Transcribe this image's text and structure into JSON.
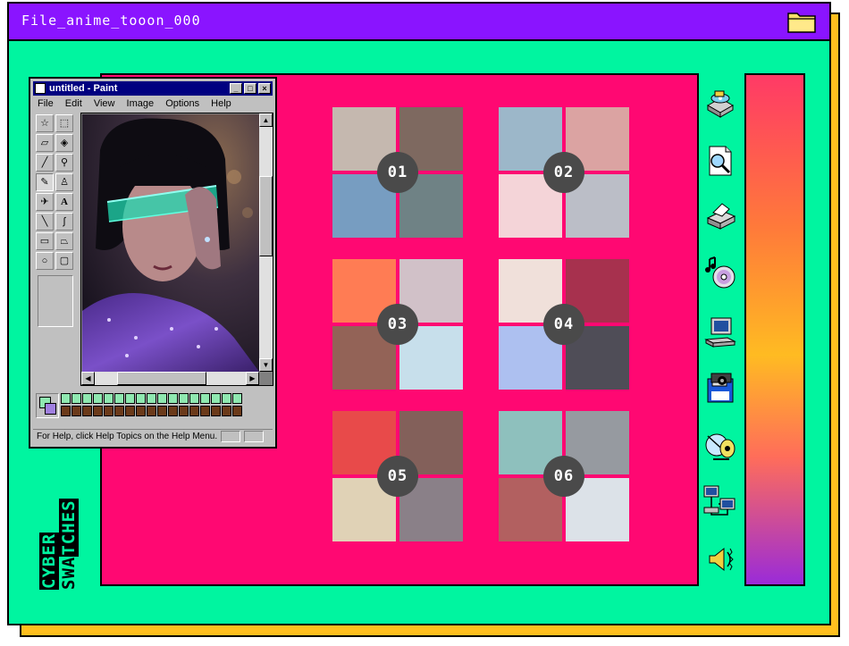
{
  "window": {
    "title": "File_anime_tooon_000",
    "icon": "folder-icon"
  },
  "colors": {
    "frame_bg": "#00f5a0",
    "titlebar": "#8a14ff",
    "shadow": "#ffbf1f",
    "panel": "#ff0872",
    "badge": "#4a4a4a"
  },
  "swatch_groups": [
    {
      "label": "01",
      "colors": [
        "#c5b8af",
        "#7e6960",
        "#779dc1",
        "#6f8285"
      ]
    },
    {
      "label": "02",
      "colors": [
        "#9cb7c9",
        "#dba3a2",
        "#f4d4d8",
        "#bbbec7"
      ]
    },
    {
      "label": "03",
      "colors": [
        "#ff7c54",
        "#d1c1c8",
        "#936357",
        "#c7dfeb"
      ]
    },
    {
      "label": "04",
      "colors": [
        "#f0e0da",
        "#a7314e",
        "#adc0f0",
        "#4f4d57"
      ]
    },
    {
      "label": "05",
      "colors": [
        "#e84a4a",
        "#83605a",
        "#e0d2b6",
        "#8a8088"
      ]
    },
    {
      "label": "06",
      "colors": [
        "#8ec0bd",
        "#969aa0",
        "#b26060",
        "#dce2e8"
      ]
    }
  ],
  "side_label": {
    "line1": "CYBER",
    "line2": "SWATCHES"
  },
  "desktop_icons": [
    "disk-drive-icon",
    "find-file-icon",
    "printer-icon",
    "media-cd-icon",
    "computer-icon",
    "camera-disk-icon",
    "satellite-dish-icon",
    "network-icon",
    "speaker-icon"
  ],
  "paint": {
    "title": "untitled - Paint",
    "menu": [
      "File",
      "Edit",
      "View",
      "Image",
      "Options",
      "Help"
    ],
    "status": "For Help, click Help Topics on the Help Menu.",
    "palette_top": [
      "#8fe8b0",
      "#8fe8b0",
      "#8fe8b0",
      "#8fe8b0",
      "#8fe8b0",
      "#8fe8b0",
      "#8fe8b0",
      "#8fe8b0",
      "#8fe8b0",
      "#8fe8b0",
      "#8fe8b0",
      "#8fe8b0",
      "#8fe8b0",
      "#8fe8b0",
      "#8fe8b0",
      "#8fe8b0",
      "#8fe8b0"
    ],
    "palette_bottom": [
      "#6b3a1a",
      "#6b3a1a",
      "#6b3a1a",
      "#6b3a1a",
      "#6b3a1a",
      "#6b3a1a",
      "#6b3a1a",
      "#6b3a1a",
      "#6b3a1a",
      "#6b3a1a",
      "#6b3a1a",
      "#6b3a1a",
      "#6b3a1a",
      "#6b3a1a",
      "#6b3a1a",
      "#6b3a1a",
      "#6b3a1a"
    ]
  }
}
